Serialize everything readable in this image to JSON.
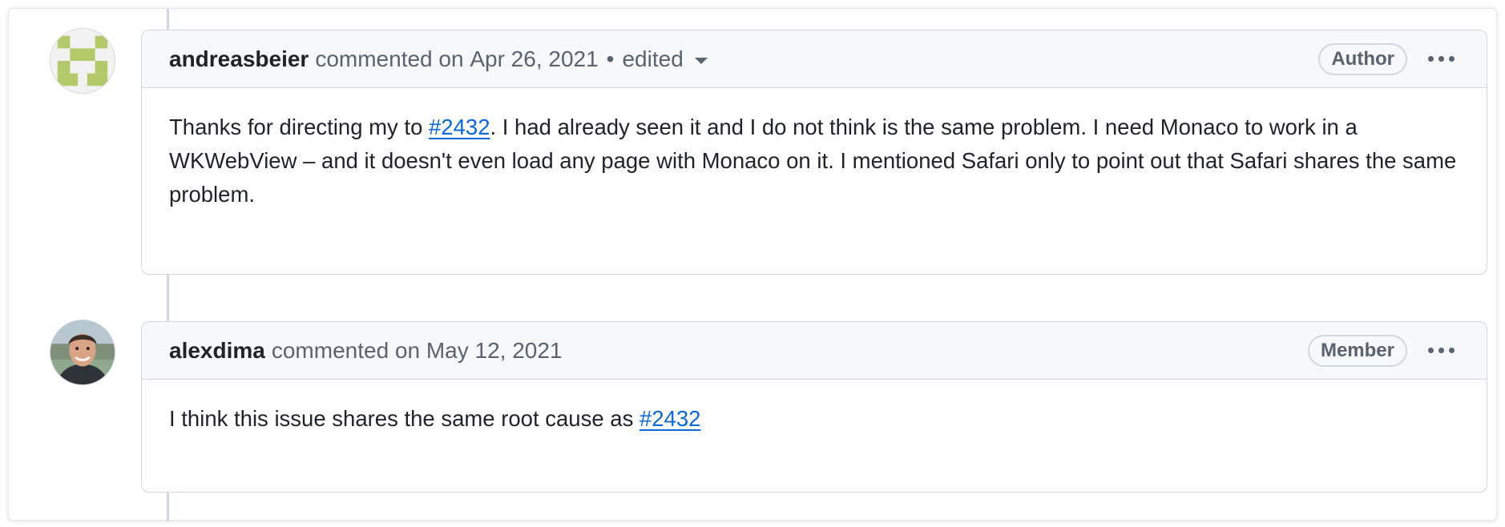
{
  "comments": [
    {
      "author": "andreasbeier",
      "action": "commented on",
      "date": "Apr 26, 2021",
      "separator": "•",
      "edited_label": "edited",
      "role_badge": "Author",
      "avatar_type": "identicon",
      "avatar_color": "#b4c96a",
      "body": {
        "part1": "Thanks for directing my to ",
        "link": "#2432",
        "part2": ". I had already seen it and I do not think is the same problem. I need Monaco to work in a WKWebView – and it doesn't even load any page with Monaco on it. I mentioned Safari only to point out that Safari shares the same problem."
      }
    },
    {
      "author": "alexdima",
      "action": "commented on",
      "date": "May 12, 2021",
      "role_badge": "Member",
      "avatar_type": "photo",
      "body": {
        "part1": "I think this issue shares the same root cause as ",
        "link": "#2432"
      }
    }
  ],
  "icons": {
    "options_menu": "kebab-horizontal-icon",
    "edited_dropdown": "triangle-down-icon"
  },
  "colors": {
    "link": "#0969da",
    "header_bg": "#f6f8fa",
    "border": "#d0d7de"
  }
}
